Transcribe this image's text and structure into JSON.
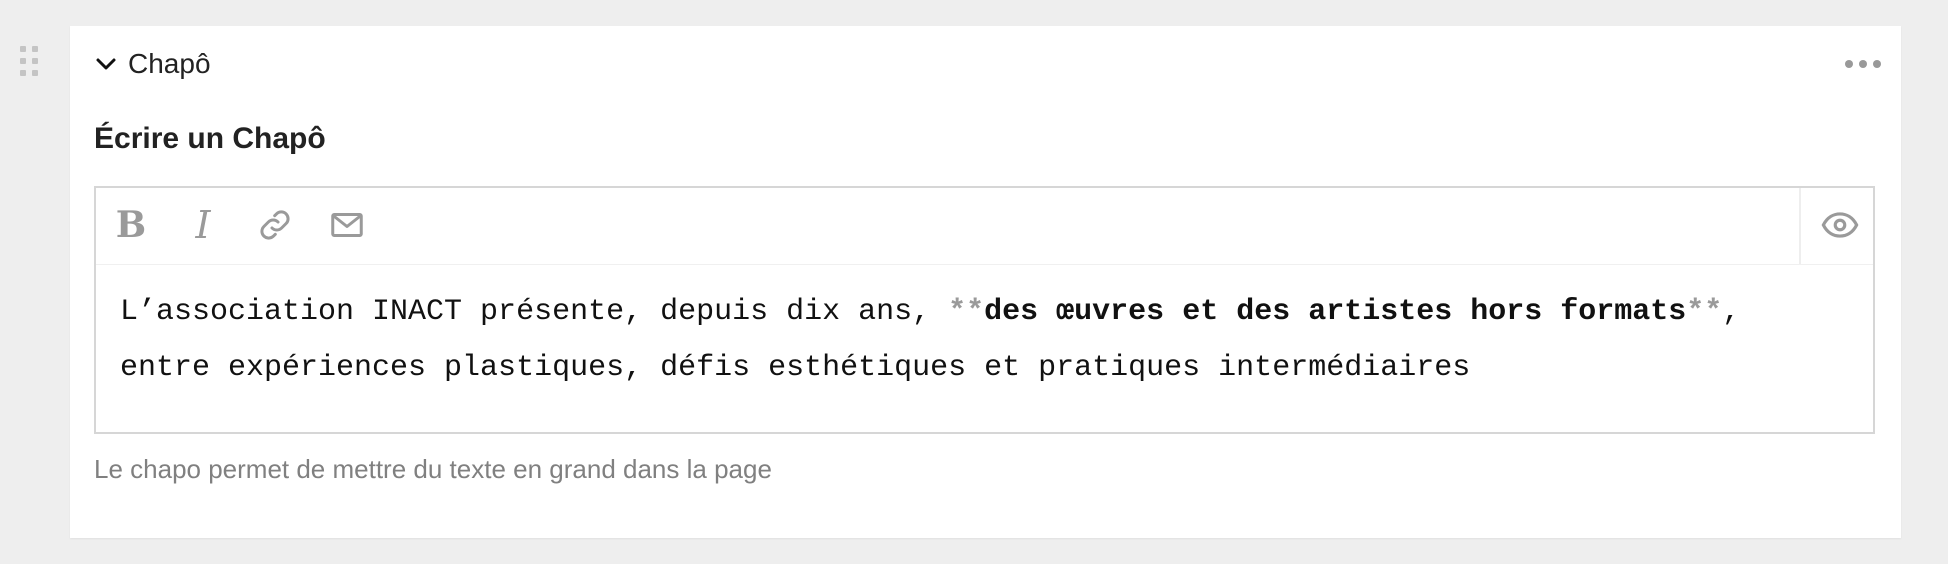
{
  "block": {
    "title": "Chapô"
  },
  "field": {
    "label": "Écrire un Chapô",
    "help": "Le chapo permet de mettre du texte en grand dans la page"
  },
  "toolbar": {
    "bold_glyph": "B",
    "italic_glyph": "I",
    "icons": [
      "bold-icon",
      "italic-icon",
      "link-icon",
      "email-icon",
      "eye-icon"
    ]
  },
  "editor": {
    "text_before": "L’association INACT présente, depuis dix ans, ",
    "mark_open": "**",
    "bold_text": "des œuvres et des artistes hors formats",
    "mark_close": "**",
    "text_after": ",\nentre expériences plastiques, défis esthétiques et pratiques intermédiaires"
  },
  "colors": {
    "background": "#eeeeee",
    "card": "#ffffff",
    "icon": "#9a9a9a",
    "help_text": "#808080"
  }
}
